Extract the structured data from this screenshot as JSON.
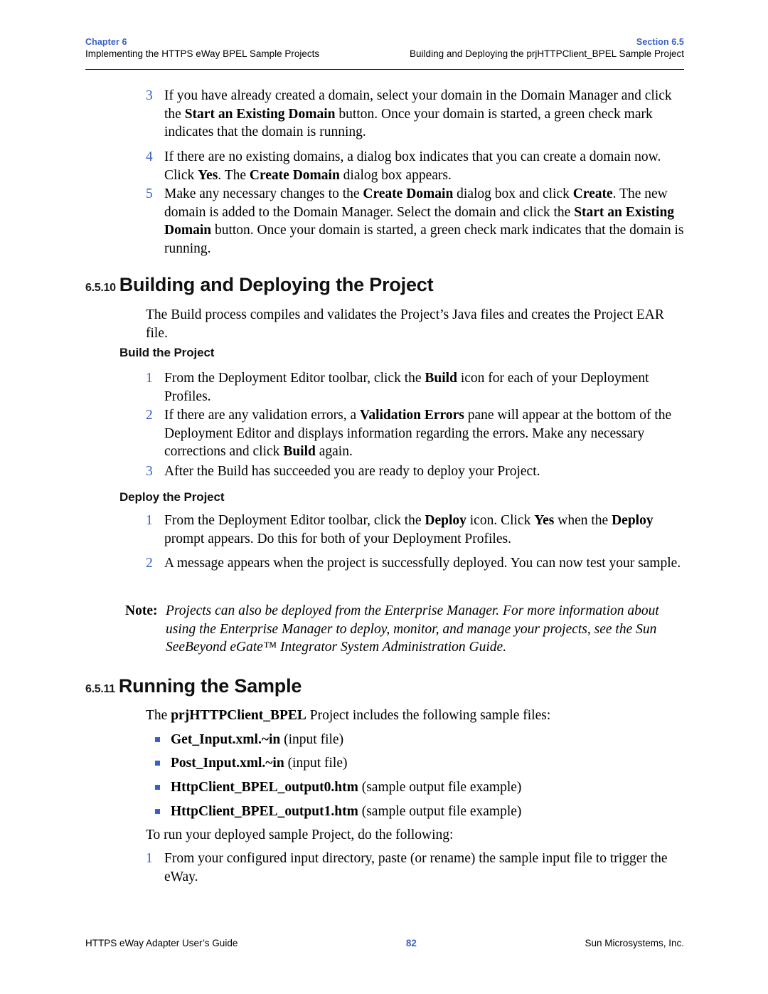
{
  "colors": {
    "accent_blue": "#3a5fc8",
    "text": "#000000",
    "rule": "#000000"
  },
  "header": {
    "left_tag": "Chapter 6",
    "left_title": "Implementing the HTTPS eWay BPEL Sample Projects",
    "right_tag": "Section 6.5",
    "right_title": "Building and Deploying the prjHTTPClient_BPEL Sample Project"
  },
  "steps_top": [
    {
      "num": "3",
      "runs": [
        {
          "t": "If you have already created a domain, select your domain in the Domain Manager and click the ",
          "b": false
        },
        {
          "t": "Start an Existing Domain",
          "b": true
        },
        {
          "t": " button. Once your domain is started, a green check mark indicates that the domain is running.",
          "b": false
        }
      ]
    },
    {
      "num": "4",
      "runs": [
        {
          "t": "If there are no existing domains, a dialog box indicates that you can create a domain now. Click ",
          "b": false
        },
        {
          "t": "Yes",
          "b": true
        },
        {
          "t": ". The ",
          "b": false
        },
        {
          "t": "Create Domain",
          "b": true
        },
        {
          "t": " dialog box appears.",
          "b": false
        }
      ]
    },
    {
      "num": "5",
      "runs": [
        {
          "t": "Make any necessary changes to the ",
          "b": false
        },
        {
          "t": "Create Domain",
          "b": true
        },
        {
          "t": " dialog box and click ",
          "b": false
        },
        {
          "t": "Create",
          "b": true
        },
        {
          "t": ". The new domain is added to the Domain Manager. Select the domain and click the ",
          "b": false
        },
        {
          "t": "Start an Existing Domain",
          "b": true
        },
        {
          "t": " button. Once your domain is started, a green check mark indicates that the domain is running.",
          "b": false
        }
      ]
    }
  ],
  "section_6510": {
    "number": "6.5.10",
    "title": "Building and Deploying the Project",
    "intro": "The Build process compiles and validates the Project’s Java files and creates the Project EAR file.",
    "build_heading": "Build the Project",
    "build_steps": [
      {
        "num": "1",
        "runs": [
          {
            "t": "From the Deployment Editor toolbar, click the ",
            "b": false
          },
          {
            "t": "Build",
            "b": true
          },
          {
            "t": " icon for each of your Deployment Profiles.",
            "b": false
          }
        ]
      },
      {
        "num": "2",
        "runs": [
          {
            "t": "If there are any validation errors, a ",
            "b": false
          },
          {
            "t": "Validation Errors",
            "b": true
          },
          {
            "t": " pane will appear at the bottom of the Deployment Editor and displays information regarding the errors. Make any necessary corrections and click ",
            "b": false
          },
          {
            "t": "Build",
            "b": true
          },
          {
            "t": " again.",
            "b": false
          }
        ]
      },
      {
        "num": "3",
        "runs": [
          {
            "t": "After the Build has succeeded you are ready to deploy your Project.",
            "b": false
          }
        ]
      }
    ],
    "deploy_heading": "Deploy the Project",
    "deploy_steps": [
      {
        "num": "1",
        "runs": [
          {
            "t": "From the Deployment Editor toolbar, click the ",
            "b": false
          },
          {
            "t": "Deploy",
            "b": true
          },
          {
            "t": " icon. Click ",
            "b": false
          },
          {
            "t": "Yes",
            "b": true
          },
          {
            "t": " when the ",
            "b": false
          },
          {
            "t": "Deploy",
            "b": true
          },
          {
            "t": " prompt appears. Do this for both of your Deployment Profiles.",
            "b": false
          }
        ]
      },
      {
        "num": "2",
        "runs": [
          {
            "t": "A message appears when the project is successfully deployed. You can now test your sample.",
            "b": false
          }
        ]
      }
    ],
    "note": {
      "label": "Note:",
      "text": "Projects can also be deployed from the Enterprise Manager. For more information about using the Enterprise Manager to deploy, monitor, and manage your projects, see the Sun SeeBeyond eGate™ Integrator System Administration Guide."
    }
  },
  "section_6511": {
    "number": "6.5.11",
    "title": "Running the Sample",
    "intro_runs": [
      {
        "t": "The ",
        "b": false
      },
      {
        "t": "prjHTTPClient_BPEL",
        "b": true
      },
      {
        "t": " Project includes the following sample files:",
        "b": false
      }
    ],
    "files": [
      {
        "name": "Get_Input.xml.~in",
        "desc": " (input file)"
      },
      {
        "name": "Post_Input.xml.~in",
        "desc": " (input file)"
      },
      {
        "name": "HttpClient_BPEL_output0.htm",
        "desc": " (sample output file example)"
      },
      {
        "name": "HttpClient_BPEL_output1.htm",
        "desc": " (sample output file example)"
      }
    ],
    "run_intro": "To run your deployed sample Project, do the following:",
    "run_steps": [
      {
        "num": "1",
        "runs": [
          {
            "t": "From your configured input directory, paste (or rename) the sample input file to trigger the eWay.",
            "b": false
          }
        ]
      }
    ]
  },
  "footer": {
    "left": "HTTPS eWay Adapter User’s Guide",
    "page": "82",
    "right": "Sun Microsystems, Inc."
  }
}
